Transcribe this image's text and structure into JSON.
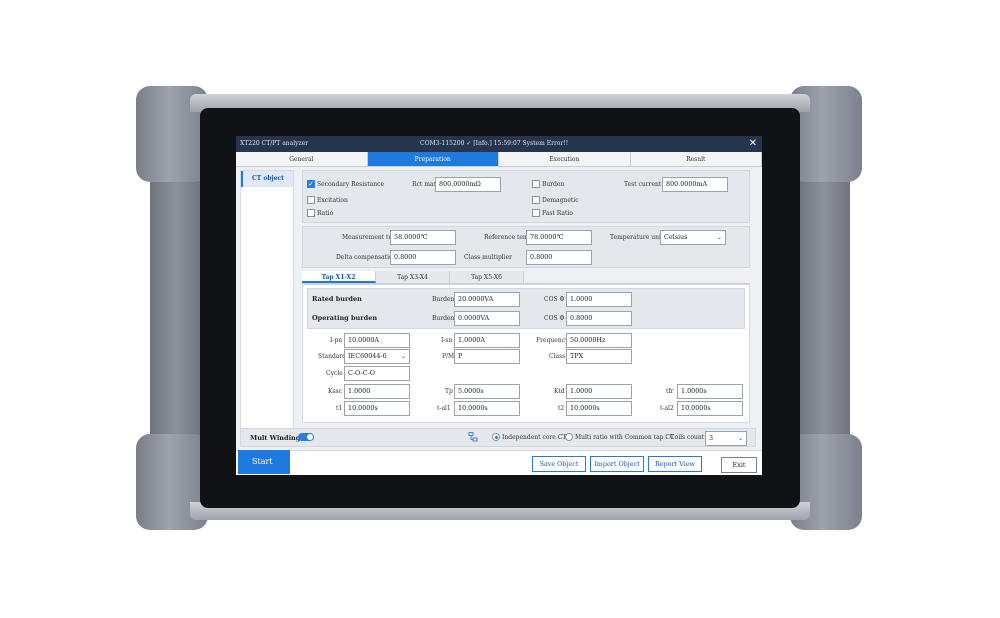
{
  "titlebar": {
    "app_title": "XT220 CT/PT analyzer",
    "status": "COM3-115200 ✓  [Info.]  15:59:07 System Error!!",
    "close_icon": "close-icon"
  },
  "tabs": [
    {
      "label": "General",
      "active": false
    },
    {
      "label": "Preparation",
      "active": true
    },
    {
      "label": "Execution",
      "active": false
    },
    {
      "label": "Result",
      "active": false
    }
  ],
  "sidebar": {
    "items": [
      {
        "label": "CT object",
        "active": true
      }
    ]
  },
  "tests": {
    "secondary_resistance": {
      "label": "Secondary Resistance",
      "checked": true
    },
    "excitation": {
      "label": "Excitation",
      "checked": false
    },
    "ratio": {
      "label": "Ratio",
      "checked": false
    },
    "burden": {
      "label": "Burden",
      "checked": false
    },
    "demagnetic": {
      "label": "Demagnetic",
      "checked": false
    },
    "fast_ratio": {
      "label": "Fast Ratio",
      "checked": false
    },
    "rct_max": {
      "label": "Rct max",
      "value": "800.0000mΩ"
    },
    "test_current": {
      "label": "Test current",
      "value": "800.0000mA"
    }
  },
  "temp": {
    "measurement_temp": {
      "label": "Measurement temp",
      "value": "58.0000℃"
    },
    "reference_temp": {
      "label": "Reference temp",
      "value": "78.0000℃"
    },
    "temperature_unit": {
      "label": "Temperature unit",
      "value": "Celsius"
    },
    "delta_compensation": {
      "label": "Delta compensation",
      "value": "0.8000"
    },
    "class_multiplier": {
      "label": "Class multiplier",
      "value": "0.8000"
    }
  },
  "subtabs": [
    {
      "label": "Tap X1-X2",
      "active": true
    },
    {
      "label": "Tap X3-X4",
      "active": false
    },
    {
      "label": "Tap X5-X6",
      "active": false
    }
  ],
  "burden": {
    "rated": {
      "label": "Rated burden",
      "burden_label": "Burden",
      "burden_value": "20.0000VA",
      "cos_label": "COS Φ",
      "cos_value": "1.0000"
    },
    "operating": {
      "label": "Operating burden",
      "burden_label": "Burden",
      "burden_value": "0.0000VA",
      "cos_label": "COS Φ",
      "cos_value": "0.8000"
    }
  },
  "params": {
    "ipn": {
      "label": "I-pn",
      "value": "10.0000A"
    },
    "isn": {
      "label": "I-sn",
      "value": "1.0000A"
    },
    "frequency": {
      "label": "Frequency",
      "value": "50.0000Hz"
    },
    "standard": {
      "label": "Standard",
      "value": "IEC60044-6"
    },
    "pm": {
      "label": "P/M",
      "value": "P"
    },
    "class": {
      "label": "Class",
      "value": "TPX"
    },
    "cycle": {
      "label": "Cycle",
      "value": "C-O-C-O"
    },
    "kssc": {
      "label": "Kssc",
      "value": "1.0000"
    },
    "tp": {
      "label": "Tp",
      "value": "5.0000s"
    },
    "ktd": {
      "label": "Ktd",
      "value": "1.0000"
    },
    "tfr": {
      "label": "tfr",
      "value": "1.0000s"
    },
    "t1": {
      "label": "t1",
      "value": "10.0000s"
    },
    "tal1": {
      "label": "t-al1",
      "value": "10.0000s"
    },
    "t2": {
      "label": "t2",
      "value": "10.0000s"
    },
    "tal2": {
      "label": "t-al2",
      "value": "10.0000s"
    }
  },
  "windings": {
    "mult_label": "Mult Windings",
    "mult_on": true,
    "independent_label": "Independent core CT",
    "multi_ratio_label": "Multi ratio with Common tap CT",
    "coils_count_label": "Coils count",
    "coils_count_value": "3"
  },
  "buttons": {
    "start": "Start",
    "save": "Save Object",
    "import": "Import Object",
    "report": "Report View",
    "exit": "Exit"
  },
  "colors": {
    "accent": "#1f7ae0",
    "titlebar": "#26344d"
  }
}
